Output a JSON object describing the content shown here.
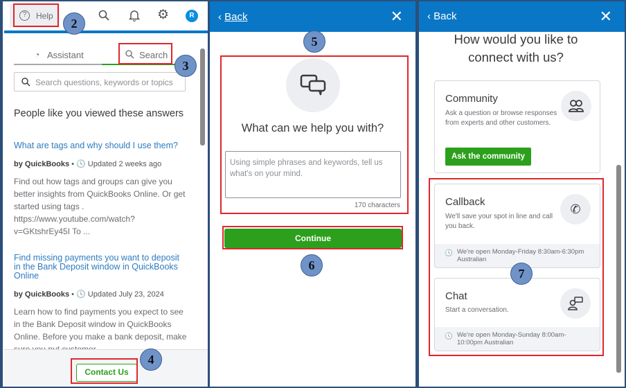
{
  "panel1": {
    "top_help": "Help",
    "avatar_initial": "R",
    "tabs": [
      {
        "label": "Assistant"
      },
      {
        "label": "Search"
      }
    ],
    "search_placeholder": "Search questions, keywords or topics",
    "heading": "People like you viewed these answers",
    "articles": [
      {
        "title": "What are tags and why should I use them?",
        "author": "by QuickBooks",
        "updated": "Updated 2 weeks ago",
        "snippet": "Find out how tags and groups can give you better insights from QuickBooks Online. Or get started using tags . https://www.youtube.com/watch?v=GKtshrEy45I To ..."
      },
      {
        "title": "Find missing payments you want to deposit in the Bank Deposit window in QuickBooks Online",
        "author": "by QuickBooks",
        "updated": "Updated July 23, 2024",
        "snippet": "Learn how to find payments you expect to see in the Bank Deposit window in QuickBooks Online. Before you make a bank deposit, make sure you put customer ..."
      }
    ],
    "contact_button": "Contact Us"
  },
  "panel2": {
    "back": "Back",
    "close": "✕",
    "heading": "What can we help you with?",
    "placeholder": "Using simple phrases and keywords, tell us what's on your mind.",
    "char_count": "170 characters",
    "continue": "Continue"
  },
  "panel3": {
    "back": "Back",
    "close": "✕",
    "heading": "How would you like to connect with us?",
    "community": {
      "title": "Community",
      "desc": "Ask a question or browse responses from experts and other customers.",
      "button": "Ask the community"
    },
    "callback": {
      "title": "Callback",
      "desc": "We'll save your spot in line and call you back.",
      "hours": "We're open Monday-Friday 8:30am-6:30pm Australian"
    },
    "chat": {
      "title": "Chat",
      "desc": "Start a conversation.",
      "hours": "We're open Monday-Sunday 8:00am-10:00pm Australian"
    }
  },
  "badges": [
    "2",
    "3",
    "4",
    "5",
    "6",
    "7"
  ],
  "colors": {
    "header_blue": "#0a77c6",
    "green": "#2ca01c",
    "annotation_red": "#e0262b"
  }
}
